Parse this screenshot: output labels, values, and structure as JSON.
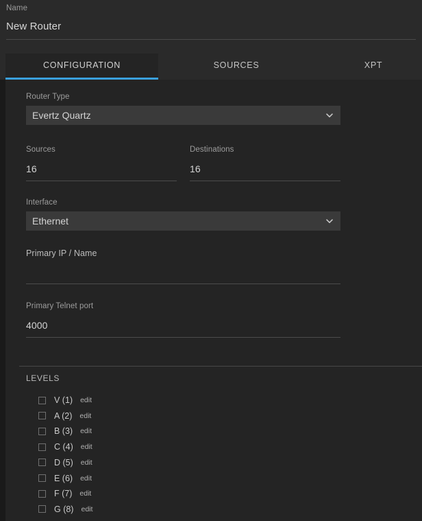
{
  "header": {
    "name_label": "Name",
    "name_value": "New Router"
  },
  "tabs": [
    {
      "label": "CONFIGURATION",
      "active": true
    },
    {
      "label": "SOURCES",
      "active": false
    },
    {
      "label": "XPT",
      "active": false
    }
  ],
  "form": {
    "router_type": {
      "label": "Router Type",
      "value": "Evertz Quartz",
      "icon": "chevron-down-icon"
    },
    "sources": {
      "label": "Sources",
      "value": "16"
    },
    "destinations": {
      "label": "Destinations",
      "value": "16"
    },
    "interface": {
      "label": "Interface",
      "value": "Ethernet",
      "icon": "chevron-down-icon"
    },
    "primary_ip": {
      "label": "Primary IP / Name",
      "value": ""
    },
    "primary_telnet_port": {
      "label": "Primary Telnet port",
      "value": "4000"
    }
  },
  "levels_section": {
    "title": "LEVELS",
    "edit_label": "edit",
    "items": [
      {
        "name": "V (1)",
        "checked": false
      },
      {
        "name": "A (2)",
        "checked": false
      },
      {
        "name": "B (3)",
        "checked": false
      },
      {
        "name": "C (4)",
        "checked": false
      },
      {
        "name": "D (5)",
        "checked": false
      },
      {
        "name": "E (6)",
        "checked": false
      },
      {
        "name": "F (7)",
        "checked": false
      },
      {
        "name": "G (8)",
        "checked": false
      }
    ]
  },
  "colors": {
    "accent": "#3aa0dd",
    "page_bg": "#1e1e1e",
    "panel_bg": "#242424",
    "header_bg": "#2a2a2a",
    "select_bg": "#3a3a3a"
  }
}
